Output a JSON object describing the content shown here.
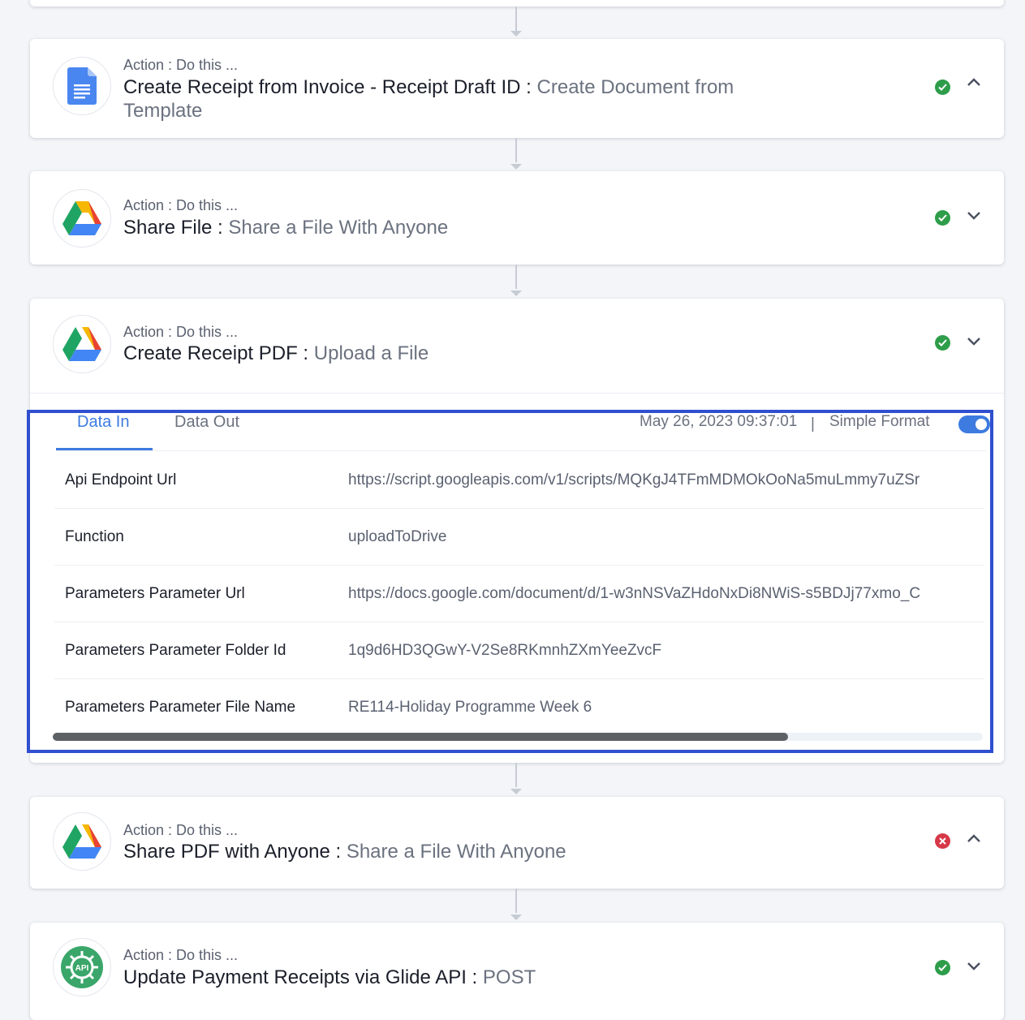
{
  "steps": [
    {
      "action_label": "Action : Do this ...",
      "app": "google-docs-icon",
      "name": "Create Receipt from Invoice - Receipt Draft ID",
      "separator": " : ",
      "event": "Create Document from Template",
      "status": "success",
      "expanded": true
    },
    {
      "action_label": "Action : Do this ...",
      "app": "google-drive-icon",
      "name": "Share File",
      "separator": " : ",
      "event": "Share a File With Anyone",
      "status": "success",
      "expanded": false
    },
    {
      "action_label": "Action : Do this ...",
      "app": "google-drive-icon",
      "name": "Create Receipt PDF",
      "separator": " : ",
      "event": "Upload a File",
      "status": "success",
      "expanded": false
    },
    {
      "action_label": "Action : Do this ...",
      "app": "google-drive-icon",
      "name": "Share PDF with Anyone",
      "separator": " : ",
      "event": "Share a File With Anyone",
      "status": "error",
      "expanded": true
    },
    {
      "action_label": "Action : Do this ...",
      "app": "api-icon",
      "icon_text": "API",
      "name": "Update Payment Receipts via Glide API",
      "separator": " : ",
      "event": "POST",
      "status": "success",
      "expanded": false
    }
  ],
  "panel": {
    "tabs": [
      "Data In",
      "Data Out"
    ],
    "active_tab": "Data In",
    "timestamp": "May 26, 2023 09:37:01",
    "divider": "|",
    "format_label": "Simple Format",
    "simple_format_on": true,
    "rows": [
      {
        "key": "Api Endpoint Url",
        "value": "https://script.googleapis.com/v1/scripts/MQKgJ4TFmMDMOkOoNa5muLmmy7uZSr"
      },
      {
        "key": "Function",
        "value": "uploadToDrive"
      },
      {
        "key": "Parameters Parameter Url",
        "value": "https://docs.google.com/document/d/1-w3nNSVaZHdoNxDi8NWiS-s5BDJj77xmo_C"
      },
      {
        "key": "Parameters Parameter Folder Id",
        "value": "1q9d6HD3QGwY-V2Se8RKmnhZXmYeeZvcF"
      },
      {
        "key": "Parameters Parameter File Name",
        "value": "RE114-Holiday Programme Week 6"
      }
    ],
    "horizontal_scroll_fraction": 0.79
  },
  "colors": {
    "accent": "#3d7be0",
    "success": "#2e9d4a",
    "error": "#d63848",
    "highlight_border": "#2f4fcf"
  }
}
